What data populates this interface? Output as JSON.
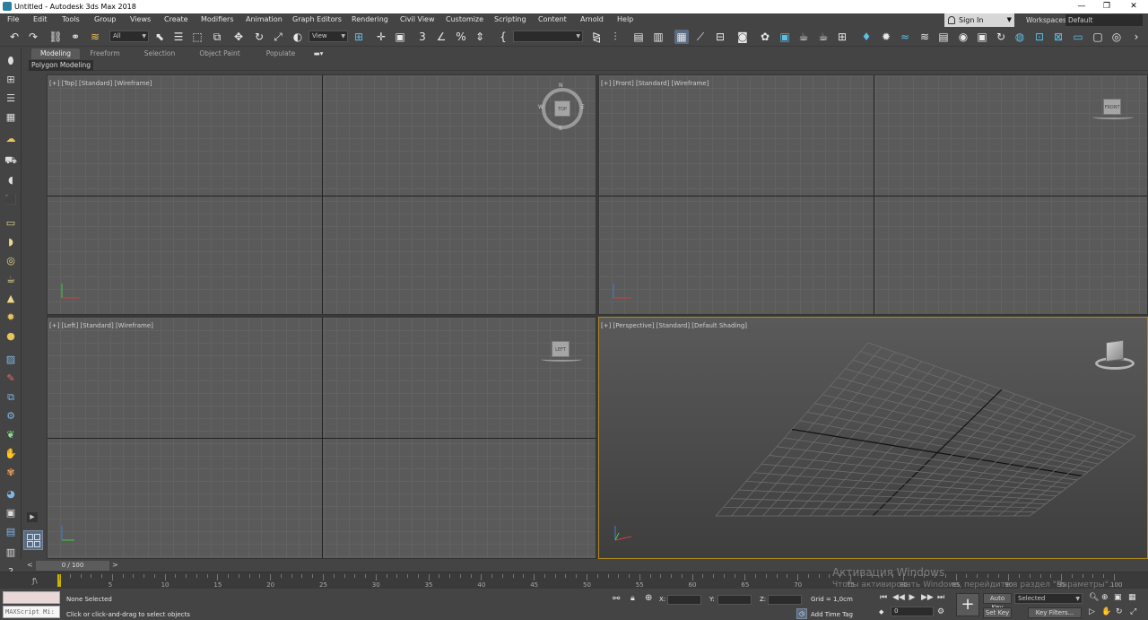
{
  "window": {
    "title": "Untitled - Autodesk 3ds Max 2018",
    "minimize": "—",
    "maximize": "❐",
    "close": "✕"
  },
  "menu": [
    "File",
    "Edit",
    "Tools",
    "Group",
    "Views",
    "Create",
    "Modifiers",
    "Animation",
    "Graph Editors",
    "Rendering",
    "Civil View",
    "Customize",
    "Scripting",
    "Content",
    "Arnold",
    "Help"
  ],
  "account": {
    "sign_in": "Sign In",
    "workspaces_label": "Workspaces:",
    "workspace": "Default"
  },
  "toolbar": {
    "selection_filter": "All",
    "ref_coord": "View",
    "named_sel": ""
  },
  "ribbon": {
    "tabs": [
      "Modeling",
      "Freeform",
      "Selection",
      "Object Paint",
      "Populate"
    ],
    "active_tab": "Modeling",
    "panel": "Polygon Modeling"
  },
  "viewports": {
    "top": {
      "label": "[+] [Top] [Standard] [Wireframe]",
      "cube": "TOP",
      "n": "N",
      "s": "S",
      "w": "W",
      "e": "E"
    },
    "front": {
      "label": "[+] [Front] [Standard] [Wireframe]",
      "cube": "FRONT"
    },
    "left": {
      "label": "[+] [Left] [Standard] [Wireframe]",
      "cube": "LEFT"
    },
    "persp": {
      "label": "[+] [Perspective] [Standard] [Default Shading]"
    }
  },
  "timeline": {
    "frame": "0 / 100",
    "ticks": [
      "0",
      "5",
      "10",
      "15",
      "20",
      "25",
      "30",
      "35",
      "40",
      "45",
      "50",
      "55",
      "60",
      "65",
      "70",
      "75",
      "80",
      "85",
      "90",
      "95",
      "100"
    ]
  },
  "status": {
    "maxscript": "MAXScript Mi:",
    "selection": "None Selected",
    "prompt": "Click or click-and-drag to select objects",
    "x_label": "X:",
    "y_label": "Y:",
    "z_label": "Z:",
    "grid": "Grid = 1,0cm",
    "add_time_tag": "Add Time Tag",
    "auto_key": "Auto Key",
    "set_key": "Set Key",
    "key_mode": "Selected",
    "key_filters": "Key Filters...",
    "frame": "0"
  },
  "watermark": {
    "line1": "Активация Windows",
    "line2": "Чтобы активировать Windows, перейдите в раздел \"Параметры\"."
  }
}
